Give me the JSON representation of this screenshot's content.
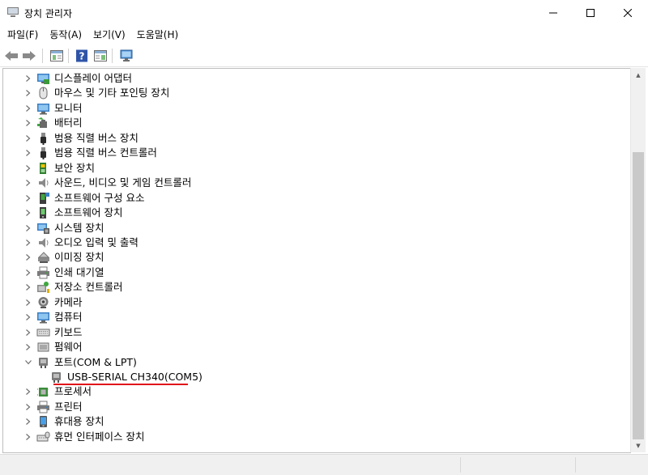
{
  "window": {
    "title": "장치 관리자"
  },
  "menu": [
    "파일(F)",
    "동작(A)",
    "보기(V)",
    "도움말(H)"
  ],
  "toolbar": {
    "buttons": [
      "back-icon",
      "forward-icon",
      "properties-panel-icon",
      "help-icon",
      "action-panel-icon",
      "monitor-scan-icon"
    ]
  },
  "tree": {
    "items": [
      {
        "label": "디스플레이 어댑터",
        "icon": "display-adapter-icon",
        "expanded": false
      },
      {
        "label": "마우스 및 기타 포인팅 장치",
        "icon": "mouse-icon",
        "expanded": false
      },
      {
        "label": "모니터",
        "icon": "monitor-icon",
        "expanded": false
      },
      {
        "label": "배터리",
        "icon": "battery-icon",
        "expanded": false
      },
      {
        "label": "범용 직렬 버스 장치",
        "icon": "usb-icon",
        "expanded": false
      },
      {
        "label": "범용 직렬 버스 컨트롤러",
        "icon": "usb-icon",
        "expanded": false
      },
      {
        "label": "보안 장치",
        "icon": "security-device-icon",
        "expanded": false
      },
      {
        "label": "사운드, 비디오 및 게임 컨트롤러",
        "icon": "speaker-icon",
        "expanded": false
      },
      {
        "label": "소프트웨어 구성 요소",
        "icon": "software-component-icon",
        "expanded": false
      },
      {
        "label": "소프트웨어 장치",
        "icon": "software-device-icon",
        "expanded": false
      },
      {
        "label": "시스템 장치",
        "icon": "system-device-icon",
        "expanded": false
      },
      {
        "label": "오디오 입력 및 출력",
        "icon": "speaker-icon",
        "expanded": false
      },
      {
        "label": "이미징 장치",
        "icon": "imaging-device-icon",
        "expanded": false
      },
      {
        "label": "인쇄 대기열",
        "icon": "print-queue-icon",
        "expanded": false
      },
      {
        "label": "저장소 컨트롤러",
        "icon": "storage-controller-icon",
        "expanded": false
      },
      {
        "label": "카메라",
        "icon": "camera-icon",
        "expanded": false
      },
      {
        "label": "컴퓨터",
        "icon": "computer-icon",
        "expanded": false
      },
      {
        "label": "키보드",
        "icon": "keyboard-icon",
        "expanded": false
      },
      {
        "label": "펌웨어",
        "icon": "firmware-icon",
        "expanded": false
      },
      {
        "label": "포트(COM & LPT)",
        "icon": "port-icon",
        "expanded": true
      },
      {
        "label": "USB-SERIAL CH340(COM5)",
        "icon": "port-icon",
        "child": true
      },
      {
        "label": "프로세서",
        "icon": "processor-icon",
        "expanded": false
      },
      {
        "label": "프린터",
        "icon": "printer-icon",
        "expanded": false
      },
      {
        "label": "휴대용 장치",
        "icon": "portable-device-icon",
        "expanded": false
      },
      {
        "label": "휴먼 인터페이스 장치",
        "icon": "human-interface-icon",
        "expanded": false
      }
    ]
  },
  "colors": {
    "highlight_underline": "#e0101a"
  }
}
